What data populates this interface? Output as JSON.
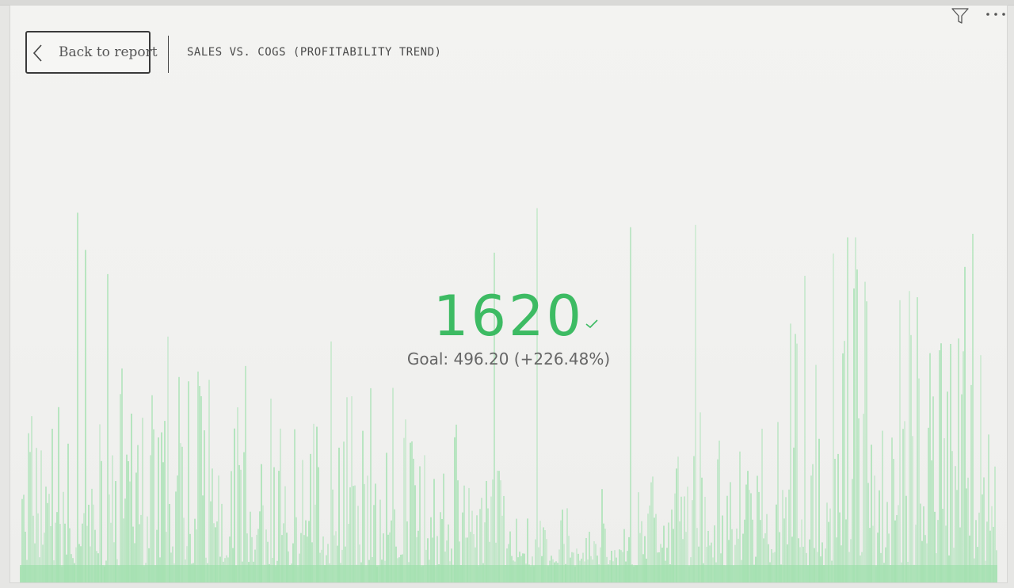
{
  "window": {
    "filter_icon": "filter-icon",
    "more_icon": "more-options-icon"
  },
  "header": {
    "back_label": "Back to report",
    "back_icon": "chevron-left-icon",
    "title": "SALES VS. COGS (PROFITABILITY TREND)"
  },
  "kpi": {
    "value": "1620",
    "goal_text": "Goal: 496.20 (+226.48%)",
    "status_icon": "check-icon",
    "value_color": "#3dbb63"
  },
  "trend": {
    "fill_color": "#9fe0ad"
  }
}
